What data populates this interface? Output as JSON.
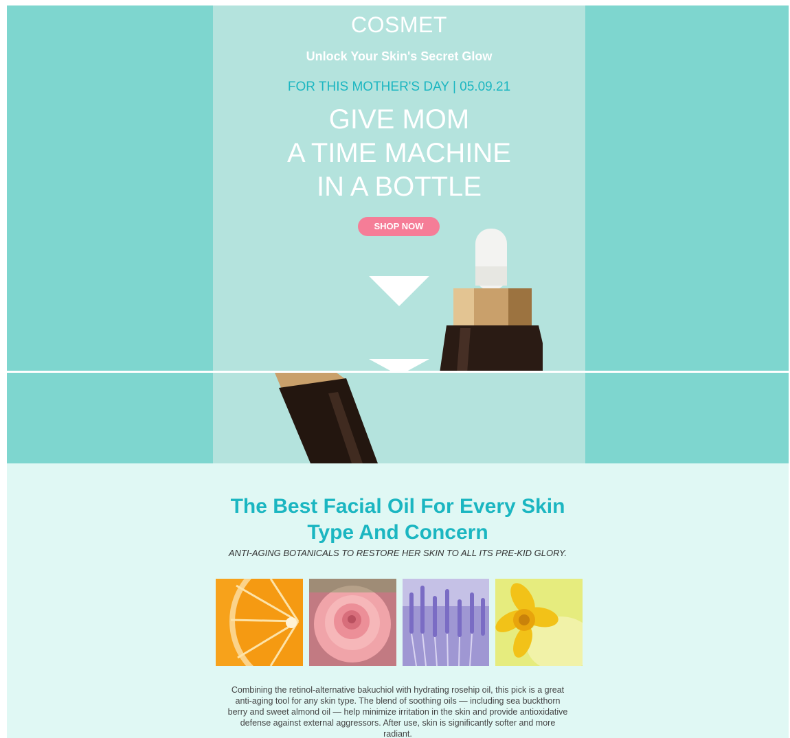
{
  "hero": {
    "brand": "COSMET",
    "tagline": "Unlock Your Skin's Secret Glow",
    "promo": "FOR THIS MOTHER'S DAY | 05.09.21",
    "headline_lines": [
      "GIVE MOM",
      "A TIME MACHINE",
      "IN A BOTTLE"
    ],
    "cta_label": "SHOP NOW"
  },
  "section": {
    "title_lines": [
      "The Best Facial Oil For Every Skin",
      "Type And Concern"
    ],
    "subtitle": "ANTI-AGING BOTANICALS TO RESTORE  HER SKIN TO ALL ITS PRE-KID GLORY.",
    "images": [
      "orange-slice",
      "pink-rose",
      "lavender",
      "daffodil"
    ],
    "description": "Combining the retinol-alternative bakuchiol with hydrating rosehip oil, this pick is a great anti-aging tool for any skin type. The blend of soothing oils — including sea buckthorn berry and sweet almond oil — help minimize irritation in the skin and provide antioxidative defense against external aggressors. After use, skin is significantly softer and more radiant."
  },
  "colors": {
    "band": "#7ed6cf",
    "panel": "#b4e3dd",
    "accent": "#1bb6c1",
    "cta": "#f57d97",
    "content_bg": "#e0f8f4"
  }
}
